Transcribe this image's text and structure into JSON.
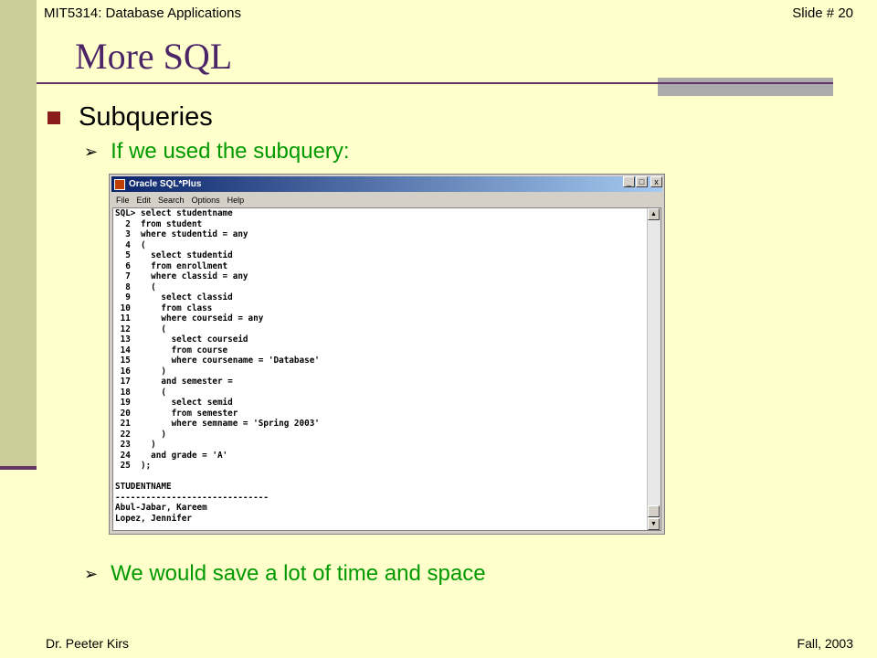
{
  "header": {
    "course": "MIT5314:  Database Applications",
    "slide": "Slide # 20"
  },
  "title": "More SQL",
  "main_bullet": "Subqueries",
  "sub_bullets": [
    "If we used the subquery:",
    "We would save a lot of time and space"
  ],
  "window": {
    "title": "Oracle SQL*Plus",
    "controls": [
      "_",
      "□",
      "x"
    ],
    "menu": [
      "File",
      "Edit",
      "Search",
      "Options",
      "Help"
    ],
    "console_lines": [
      "SQL> select studentname",
      "  2  from student",
      "  3  where studentid = any",
      "  4  (",
      "  5    select studentid",
      "  6    from enrollment",
      "  7    where classid = any",
      "  8    (",
      "  9      select classid",
      " 10      from class",
      " 11      where courseid = any",
      " 12      (",
      " 13        select courseid",
      " 14        from course",
      " 15        where coursename = 'Database'",
      " 16      )",
      " 17      and semester =",
      " 18      (",
      " 19        select semid",
      " 20        from semester",
      " 21        where semname = 'Spring 2003'",
      " 22      )",
      " 23    )",
      " 24    and grade = 'A'",
      " 25  );",
      "",
      "STUDENTNAME",
      "------------------------------",
      "Abul-Jabar, Kareem",
      "Lopez, Jennifer"
    ]
  },
  "footer": {
    "author": "Dr. Peeter Kirs",
    "term": "Fall, 2003"
  },
  "colors": {
    "background": "#FFFFCC",
    "title": "#4B2567",
    "sub_bullet_text": "#009900",
    "bullet_square": "#8B1C1C"
  }
}
